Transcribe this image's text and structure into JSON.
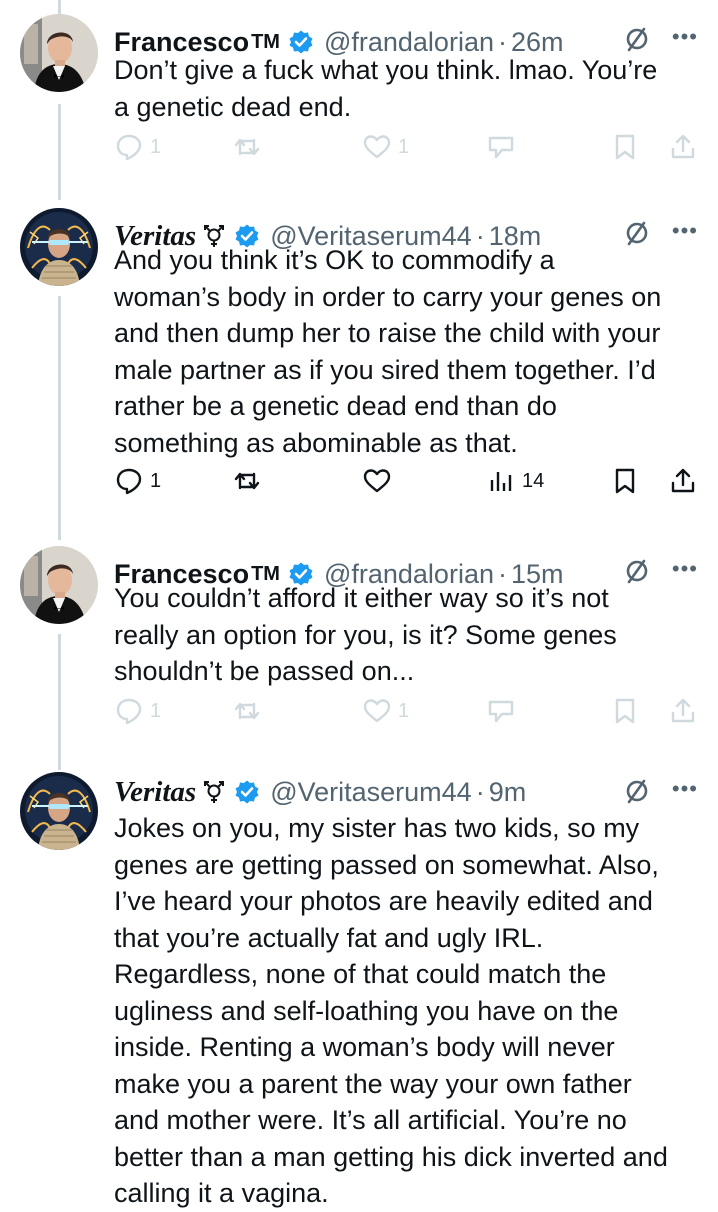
{
  "tweets": [
    {
      "name": "Francesco",
      "badge": "TM",
      "handle": "@frandalorian",
      "time": "26m",
      "text": "Don’t give a fuck what you think. lmao. You’re\na genetic dead end.",
      "replies": "1",
      "likes": "1",
      "views": ""
    },
    {
      "name": "Veritas",
      "badge_icon": "venus-mars-icon",
      "handle": "@Veritaserum44",
      "time": "18m",
      "text": "And you think it’s OK to commodify a\nwoman’s body in order to carry your genes on\nand then dump her to raise the child with your\nmale partner as if you sired them together. I’d\nrather be a genetic dead end than do\nsomething as abominable as that.",
      "replies": "1",
      "likes": "",
      "views": "14"
    },
    {
      "name": "Francesco",
      "badge": "TM",
      "handle": "@frandalorian",
      "time": "15m",
      "text": "You couldn’t afford it either way so it’s not\nreally an option for you, is it? Some genes\nshouldn’t be passed on...",
      "replies": "1",
      "likes": "1",
      "views": ""
    },
    {
      "name": "Veritas",
      "badge_icon": "venus-mars-icon",
      "handle": "@Veritaserum44",
      "time": "9m",
      "text": "Jokes on you, my sister has two kids, so my\ngenes are getting passed on somewhat. Also,\nI’ve heard your photos are heavily edited and\nthat you’re actually fat and ugly IRL.\nRegardless, none of that could match the\nugliness and self-loathing you have on the\ninside. Renting a woman’s body will never\nmake you a parent the way your own father\nand mother were. It’s all artificial. You’re no\nbetter than a man getting his dick inverted and\ncalling it a vagina."
    }
  ],
  "separator": "·",
  "colors": {
    "verified": "#1d9bf0",
    "muted": "#536471",
    "dimmed": "#cfd9de",
    "text": "#0f1419"
  }
}
